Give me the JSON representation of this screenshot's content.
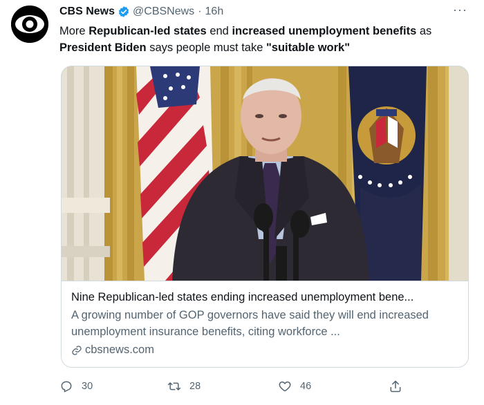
{
  "tweet": {
    "author_name": "CBS News",
    "handle": "@CBSNews",
    "separator": "·",
    "time": "16h",
    "more": "···",
    "text_parts": [
      {
        "t": "More ",
        "bold": false
      },
      {
        "t": "Republican-led states",
        "bold": true
      },
      {
        "t": " end ",
        "bold": false
      },
      {
        "t": "increased unemployment benefits",
        "bold": true
      },
      {
        "t": " as ",
        "bold": false
      },
      {
        "t": "President Biden",
        "bold": true
      },
      {
        "t": " says people must take ",
        "bold": false
      },
      {
        "t": "\"suitable work\"",
        "bold": true
      }
    ]
  },
  "card": {
    "title": "Nine Republican-led states ending increased unemployment bene...",
    "description": "A growing number of GOP governors have said they will end increased unemployment insurance benefits, citing workforce ...",
    "domain": "cbsnews.com"
  },
  "actions": {
    "replies": "30",
    "retweets": "28",
    "likes": "46"
  },
  "icons": {
    "avatar": "cbs-eye-logo",
    "verified": "verified-badge-icon",
    "link": "link-icon",
    "reply": "reply-icon",
    "retweet": "retweet-icon",
    "like": "heart-icon",
    "share": "share-icon"
  },
  "colors": {
    "text": "#0f1419",
    "secondary": "#536471",
    "verified": "#1d9bf0",
    "border": "#cfd9de"
  }
}
